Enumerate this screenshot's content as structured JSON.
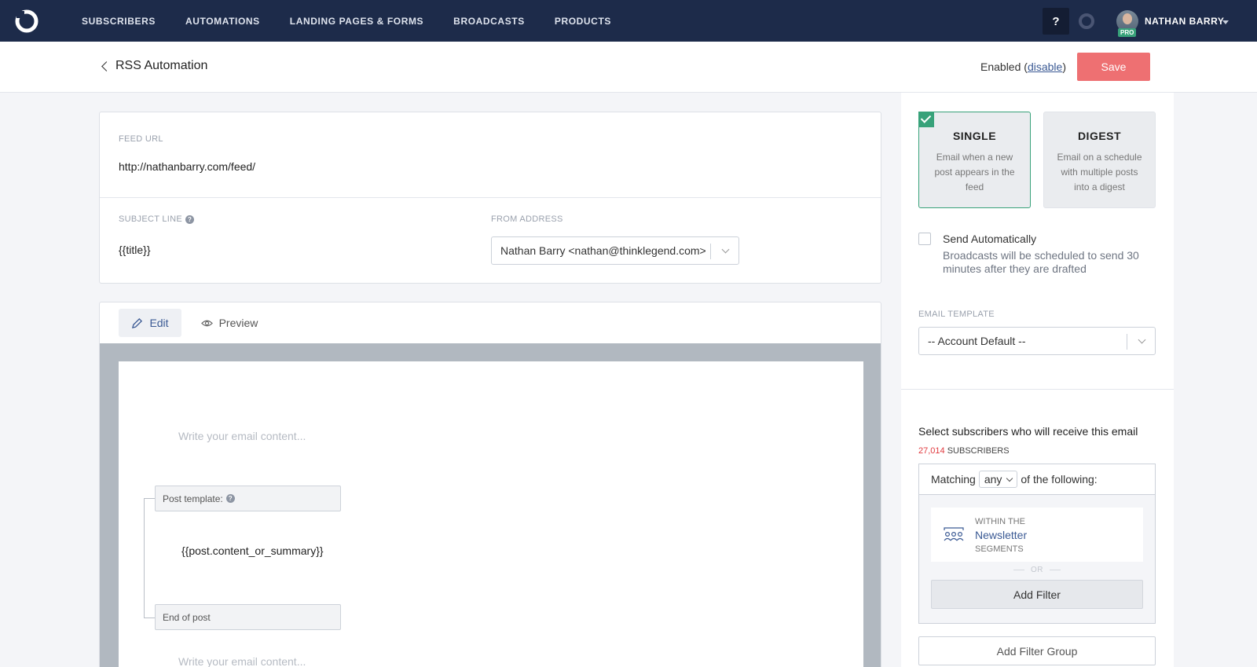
{
  "nav": {
    "links": [
      "SUBSCRIBERS",
      "AUTOMATIONS",
      "LANDING PAGES & FORMS",
      "BROADCASTS",
      "PRODUCTS"
    ],
    "help_label": "?",
    "user_name": "NATHAN BARRY",
    "pro_badge": "PRO"
  },
  "header": {
    "title": "RSS Automation",
    "status_prefix": "Enabled (",
    "status_link": "disable",
    "status_suffix": ")",
    "save_label": "Save"
  },
  "feed": {
    "url_label": "FEED URL",
    "url_value": "http://nathanbarry.com/feed/",
    "subject_label": "SUBJECT LINE",
    "subject_value": "{{title}}",
    "from_label": "FROM ADDRESS",
    "from_value": "Nathan Barry <nathan@thinklegend.com>"
  },
  "editor": {
    "tab_edit": "Edit",
    "tab_preview": "Preview",
    "placeholder": "Write your email content...",
    "placeholder_bottom": "Write your email content...",
    "post_template_label": "Post template:",
    "post_content": "{{post.content_or_summary}}",
    "end_of_post_label": "End of post"
  },
  "sidebar": {
    "modes": [
      {
        "title": "SINGLE",
        "desc": "Email when a new post appears in the feed",
        "selected": true
      },
      {
        "title": "DIGEST",
        "desc": "Email on a schedule with multiple posts into a digest",
        "selected": false
      }
    ],
    "send_auto_label": "Send Automatically",
    "send_auto_desc": "Broadcasts will be scheduled to send 30 minutes after they are drafted",
    "send_auto_checked": false,
    "template_label": "EMAIL TEMPLATE",
    "template_value": "-- Account Default --",
    "select_heading": "Select subscribers who will receive this email",
    "subscriber_count": "27,014",
    "subscriber_suffix": "SUBSCRIBERS",
    "matching_prefix": "Matching",
    "matching_value": "any",
    "matching_suffix": "of the following:",
    "segment_within": "WITHIN THE",
    "segment_name": "Newsletter",
    "segment_type": "SEGMENTS",
    "or_label": "OR",
    "add_filter_label": "Add Filter",
    "add_filter_group_label": "Add Filter Group"
  },
  "colors": {
    "nav_bg": "#1d2b4a",
    "save_button": "#ee7072",
    "selected_green": "#38a27a",
    "link_blue": "#3b5a94",
    "count_red": "#e0393e"
  }
}
